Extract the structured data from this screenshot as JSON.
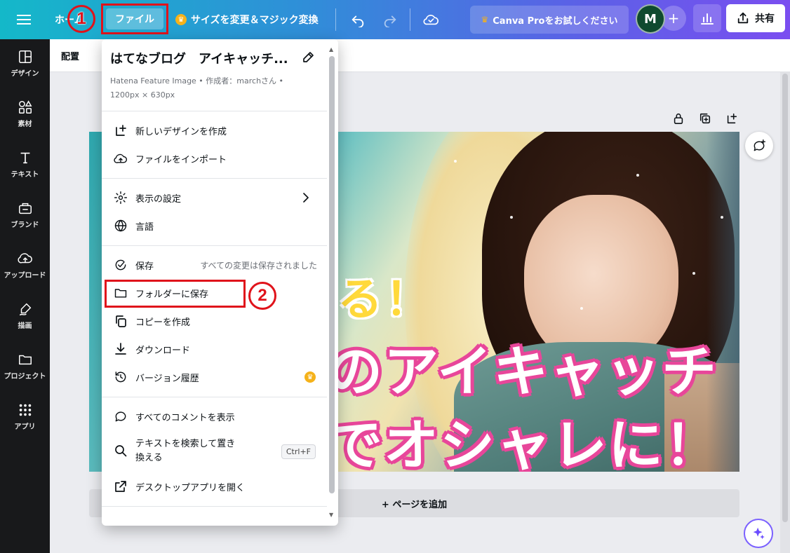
{
  "topbar": {
    "home": "ホーム",
    "file": "ファイル",
    "resize": "サイズを変更＆マジック変換",
    "pro": "Canva Proをお試しください",
    "avatar_initial": "M",
    "plus": "+",
    "share": "共有"
  },
  "steps": {
    "one": "1",
    "two": "2"
  },
  "sidebar": {
    "items": [
      {
        "label": "デザイン",
        "icon": "layout-icon"
      },
      {
        "label": "素材",
        "icon": "elements-icon"
      },
      {
        "label": "テキスト",
        "icon": "text-icon"
      },
      {
        "label": "ブランド",
        "icon": "brand-icon"
      },
      {
        "label": "アップロード",
        "icon": "upload-icon"
      },
      {
        "label": "描画",
        "icon": "draw-icon"
      },
      {
        "label": "プロジェクト",
        "icon": "folder-icon"
      },
      {
        "label": "アプリ",
        "icon": "apps-icon"
      }
    ]
  },
  "subbar": {
    "arrange": "配置"
  },
  "menu": {
    "title": "はてなブログ　アイキャッチ...",
    "meta": "Hatena Feature Image • 作成者：marchさん • 1200px × 630px",
    "items": {
      "new_design": "新しいデザインを作成",
      "import": "ファイルをインポート",
      "view_settings": "表示の設定",
      "language": "言語",
      "save": "保存",
      "save_status": "すべての変更は保存されました",
      "save_folder": "フォルダーに保存",
      "copy": "コピーを作成",
      "download": "ダウンロード",
      "version_history": "バージョン履歴",
      "show_comments": "すべてのコメントを表示",
      "find_replace": "テキストを検索して置き換える",
      "find_replace_shortcut": "Ctrl+F",
      "desktop_app": "デスクトップアプリを開く"
    }
  },
  "design": {
    "text_yellow": "る！",
    "text_line1": "のアイキャッチ",
    "text_line2": "でオシャレに！"
  },
  "canvas": {
    "add_page": "+ ページを追加"
  },
  "colors": {
    "accent_red": "#e0131b",
    "sidebar_bg": "#18191b",
    "topbar_start": "#14b8c9",
    "topbar_end": "#7a4ef0"
  }
}
